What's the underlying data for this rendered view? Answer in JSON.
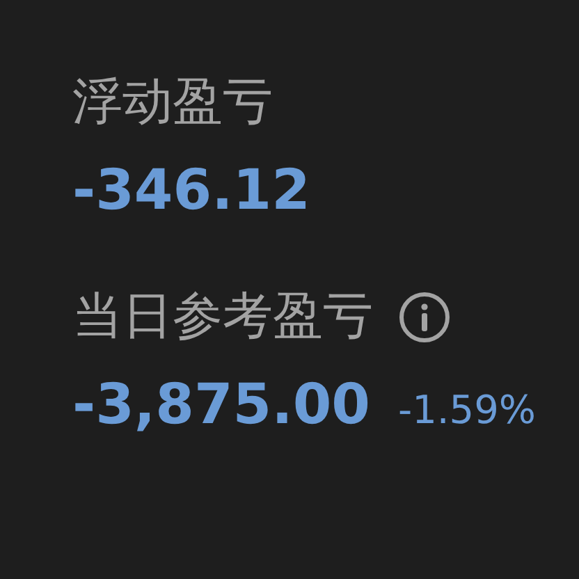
{
  "metrics": [
    {
      "label": "浮动盈亏",
      "value": "-346.12",
      "info": false
    },
    {
      "label": "当日参考盈亏",
      "value": "-3,875.00",
      "change": "-1.59%",
      "info": true
    }
  ]
}
